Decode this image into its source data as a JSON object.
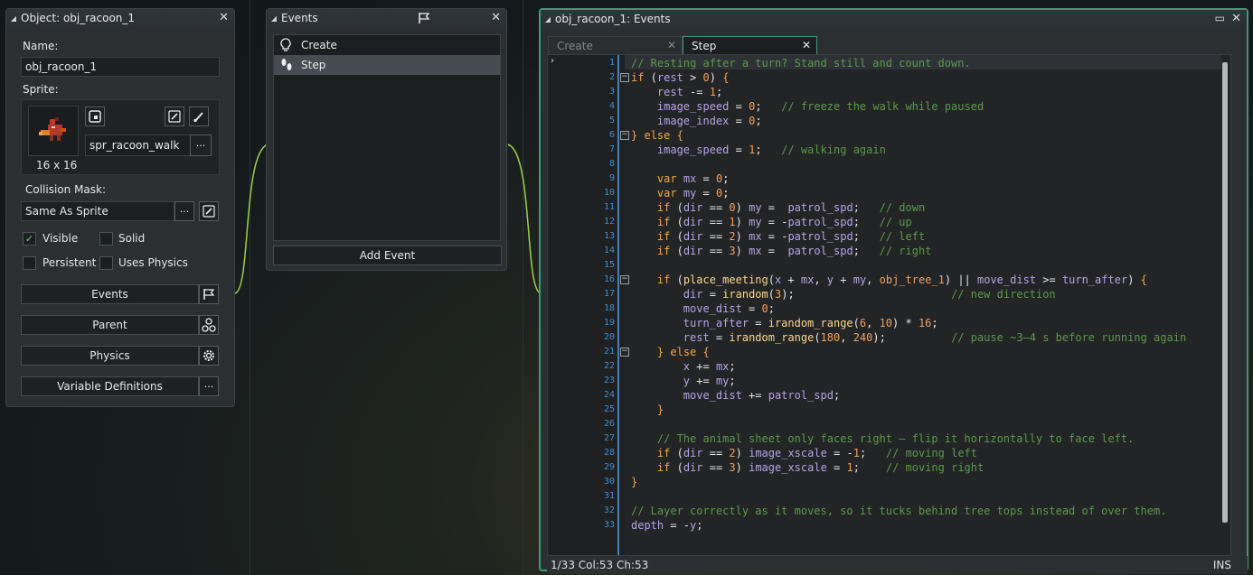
{
  "object_panel": {
    "title": "Object: obj_racoon_1",
    "name_label": "Name:",
    "name_value": "obj_racoon_1",
    "sprite_label": "Sprite:",
    "sprite_name": "spr_racoon_walk",
    "sprite_size": "16 x 16",
    "collision_label": "Collision Mask:",
    "collision_value": "Same As Sprite",
    "checkboxes": [
      {
        "label": "Visible",
        "checked": true
      },
      {
        "label": "Solid",
        "checked": false
      },
      {
        "label": "Persistent",
        "checked": false
      },
      {
        "label": "Uses Physics",
        "checked": false
      }
    ],
    "buttons": {
      "events": "Events",
      "parent": "Parent",
      "physics": "Physics",
      "variable_definitions": "Variable Definitions"
    },
    "ellipsis": "···"
  },
  "events_panel": {
    "title": "Events",
    "items": [
      {
        "label": "Create",
        "selected": false
      },
      {
        "label": "Step",
        "selected": true
      }
    ],
    "add_event": "Add Event"
  },
  "code_window": {
    "title": "obj_racoon_1: Events",
    "tabs": [
      {
        "label": "Create",
        "active": false
      },
      {
        "label": "Step",
        "active": true
      }
    ],
    "status": "1/33 Col:53 Ch:53",
    "mode": "INS",
    "line_numbers": [
      "1",
      "2",
      "3",
      "4",
      "5",
      "6",
      "7",
      "8",
      "9",
      "10",
      "11",
      "12",
      "13",
      "14",
      "15",
      "16",
      "17",
      "18",
      "19",
      "20",
      "21",
      "22",
      "23",
      "24",
      "25",
      "26",
      "27",
      "28",
      "29",
      "30",
      "31",
      "32",
      "33"
    ],
    "code_lines": [
      "// Resting after a turn? Stand still and count down.",
      "if (rest > 0) {",
      "    rest -= 1;",
      "    image_speed = 0;   // freeze the walk while paused",
      "    image_index = 0;",
      "} else {",
      "    image_speed = 1;   // walking again",
      "",
      "    var mx = 0;",
      "    var my = 0;",
      "    if (dir == 0) my =  patrol_spd;   // down",
      "    if (dir == 1) my = -patrol_spd;   // up",
      "    if (dir == 2) mx = -patrol_spd;   // left",
      "    if (dir == 3) mx =  patrol_spd;   // right",
      "",
      "    if (place_meeting(x + mx, y + my, obj_tree_1) || move_dist >= turn_after) {",
      "        dir = irandom(3);                        // new direction",
      "        move_dist = 0;",
      "        turn_after = irandom_range(6, 10) * 16;",
      "        rest = irandom_range(180, 240);          // pause ~3–4 s before running again",
      "    } else {",
      "        x += mx;",
      "        y += my;",
      "        move_dist += patrol_spd;",
      "    }",
      "",
      "    // The animal sheet only faces right — flip it horizontally to face left.",
      "    if (dir == 2) image_xscale = -1;   // moving left",
      "    if (dir == 3) image_xscale = 1;    // moving right",
      "}",
      "",
      "// Layer correctly as it moves, so it tucks behind tree tops instead of over them.",
      "depth = -y;"
    ]
  },
  "colors": {
    "accent": "#3f9a7c",
    "line_number": "#3d8fd6",
    "comment": "#5b9a4a",
    "keyword": "#f3a64a",
    "function": "#ffd68a",
    "variable": "#b7a4e6"
  }
}
